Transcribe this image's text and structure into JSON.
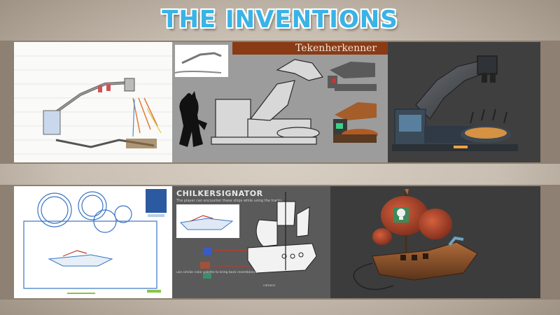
{
  "title": "THE INVENTIONS",
  "panels": {
    "tekenherkenner": {
      "header": "Tekenherkenner"
    },
    "chilker": {
      "title": "CHILKERSIGNATOR",
      "subtitle": "The player can encounter these ships while using the tracks.",
      "note": "use similar color palette to bring back resemblance",
      "camera_label": "camera"
    }
  },
  "colors": {
    "title_fill": "#3ab3e6",
    "frame_band": "#8e8072",
    "concept_header": "#8a3b16"
  }
}
